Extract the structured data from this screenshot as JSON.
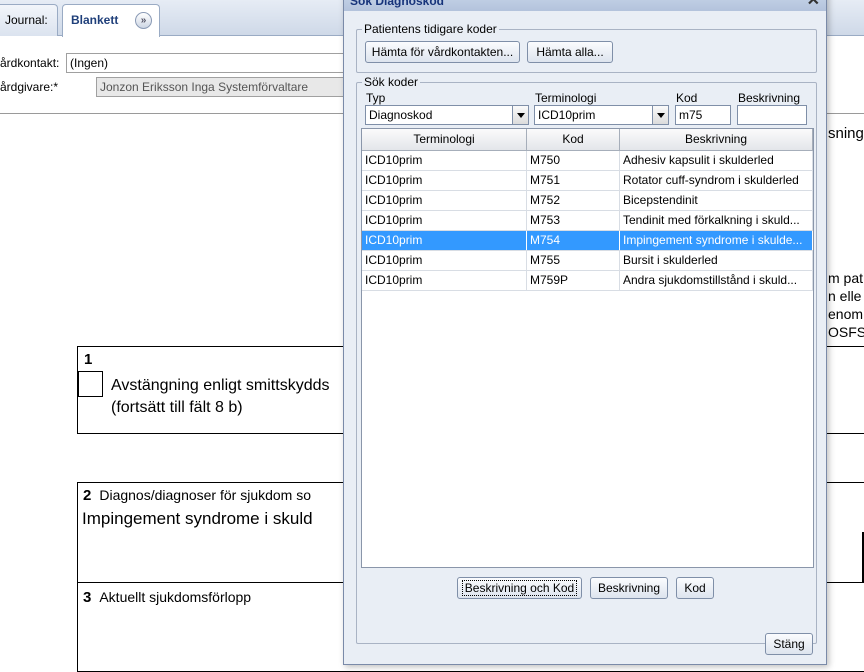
{
  "tabs": {
    "journal": "Journal:",
    "blankett": "Blankett",
    "chevron": "»"
  },
  "form": {
    "vardkontakt_label": "årdkontakt:",
    "vardkontakt_value": "(Ingen)",
    "vardgivare_label": "årdgivare:*",
    "vardgivare_value": "Jonzon Eriksson Inga Systemförvaltare"
  },
  "right_fragments": [
    "sning",
    "m pat",
    "n elle",
    "enom",
    "OSFS"
  ],
  "section1": {
    "num": "1",
    "line1": "Avstängning enligt smittskydds",
    "line2": "(fortsätt till fält 8 b)"
  },
  "section2": {
    "num": "2",
    "label": "Diagnos/diagnoser för sjukdom so",
    "value": "Impingement syndrome i skuld"
  },
  "section3": {
    "num": "3",
    "label": "Aktuellt sjukdomsförlopp"
  },
  "dialog": {
    "title": "Sök Diagnoskod",
    "group1_legend": "Patientens tidigare koder",
    "btn_hamta_vardkontakt": "Hämta för vårdkontakten...",
    "btn_hamta_alla": "Hämta alla...",
    "group2_legend": "Sök koder",
    "typ_label": "Typ",
    "typ_value": "Diagnoskod",
    "terminologi_label": "Terminologi",
    "terminologi_value": "ICD10prim",
    "kod_label": "Kod",
    "kod_value": "m75",
    "beskrivning_label": "Beskrivning",
    "beskrivning_value": "",
    "grid_headers": [
      "Terminologi",
      "Kod",
      "Beskrivning"
    ],
    "rows": [
      [
        "ICD10prim",
        "M750",
        "Adhesiv kapsulit i skulderled"
      ],
      [
        "ICD10prim",
        "M751",
        "Rotator cuff-syndrom i skulderled"
      ],
      [
        "ICD10prim",
        "M752",
        "Bicepstendinit"
      ],
      [
        "ICD10prim",
        "M753",
        "Tendinit med förkalkning i skuld..."
      ],
      [
        "ICD10prim",
        "M754",
        "Impingement syndrome i skulde..."
      ],
      [
        "ICD10prim",
        "M755",
        "Bursit i skulderled"
      ],
      [
        "ICD10prim",
        "M759P",
        "Andra sjukdomstillstånd i skuld..."
      ]
    ],
    "selected_row": 4,
    "btn_beskrivning_och_kod": "Beskrivning och Kod",
    "btn_beskrivning": "Beskrivning",
    "btn_kod": "Kod",
    "btn_stang": "Stäng",
    "close_glyph": "✕"
  },
  "colors": {
    "selection": "#3399ff",
    "dialog_bg": "#e9eef5",
    "title_text": "#16337a"
  }
}
